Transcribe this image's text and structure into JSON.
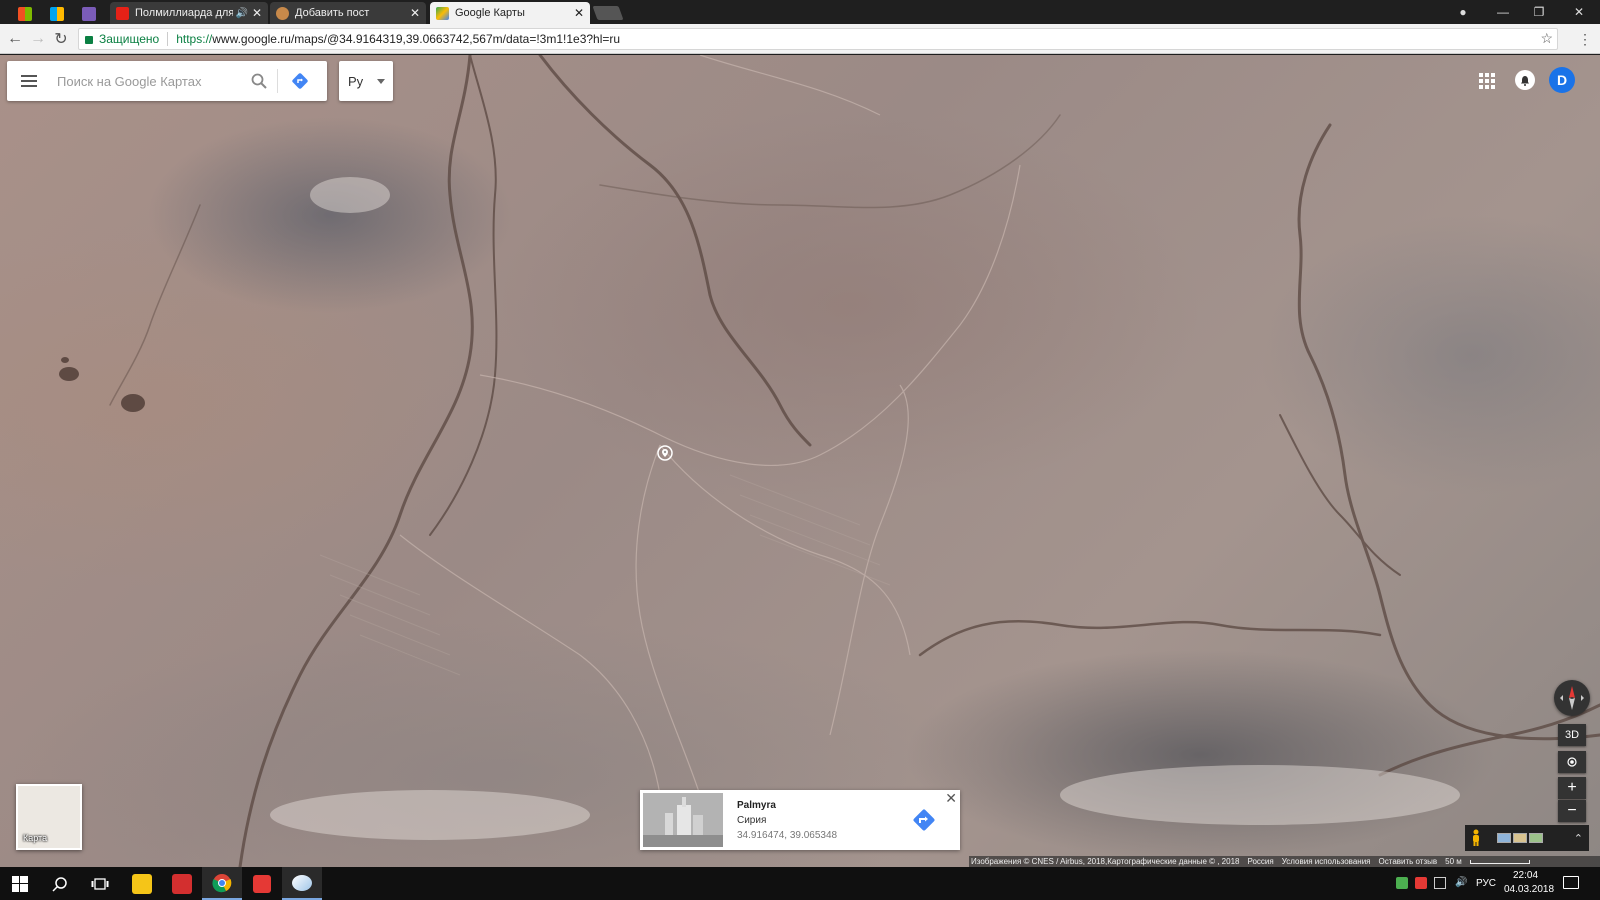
{
  "browser": {
    "tabs": [
      {
        "title": "Полмиллиарда для Г",
        "favicon": "youtube-icon",
        "audio": true
      },
      {
        "title": "Добавить пост",
        "favicon": "pikabu-icon"
      },
      {
        "title": "Google Карты",
        "favicon": "google-maps-icon",
        "active": true
      }
    ],
    "security_label": "Защищено",
    "url_protocol": "https://",
    "url_rest": "www.google.ru/maps/@34.9164319,39.0663742,567m/data=!3m1!1e3?hl=ru"
  },
  "maps": {
    "search_placeholder": "Поиск на Google Картах",
    "language": "Ру",
    "account_initial": "D",
    "map_type_label": "Карта",
    "place": {
      "name": "Palmyra",
      "country": "Сирия",
      "coords": "34.916474, 39.065348"
    },
    "controls": {
      "view_3d": "3D",
      "zoom_in": "+",
      "zoom_out": "−"
    },
    "attribution": {
      "imagery": "Изображения © CNES / Airbus, 2018,Картографические данные © , 2018",
      "region": "Россия",
      "terms": "Условия использования",
      "feedback": "Оставить отзыв",
      "scale": "50 м"
    }
  },
  "taskbar": {
    "language": "РУС",
    "time": "22:04",
    "date": "04.03.2018"
  },
  "colors": {
    "accent_blue": "#1a73e8",
    "secure_green": "#0b8043",
    "taskbar": "#101010"
  }
}
